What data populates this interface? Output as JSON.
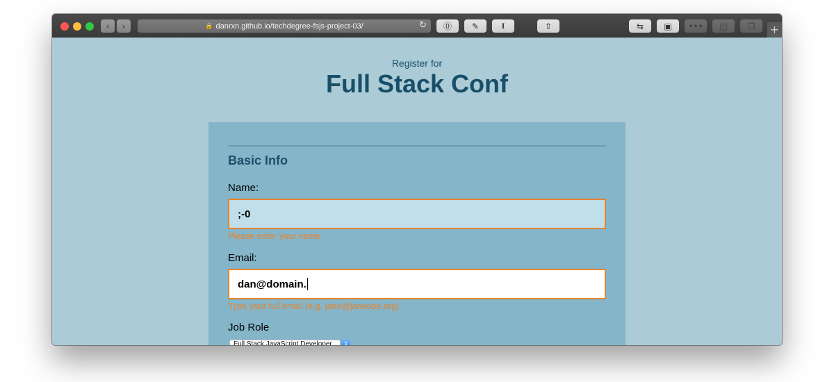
{
  "browser": {
    "url": "danrxn.github.io/techdegree-fsjs-project-03/",
    "icons": {
      "lock": "lock-icon",
      "reload": "reload-icon",
      "back": "back-icon",
      "forward": "forward-icon",
      "share": "share-icon",
      "new_tab": "plus-icon"
    }
  },
  "page": {
    "pre_title": "Register for",
    "title": "Full Stack Conf",
    "section_title": "Basic Info",
    "name_label": "Name:",
    "name_value": ";-0",
    "name_error": "Please enter your name",
    "email_label": "Email:",
    "email_value": "dan@domain.",
    "email_error": "Type your full email (e.g. jane@janedoe.org)",
    "job_role_label": "Job Role",
    "job_role_selected": "Full Stack JavaScript Developer"
  },
  "colors": {
    "background": "#abcbd7",
    "panel": "#85b5c9",
    "heading": "#184f68",
    "error": "#e4842e"
  }
}
